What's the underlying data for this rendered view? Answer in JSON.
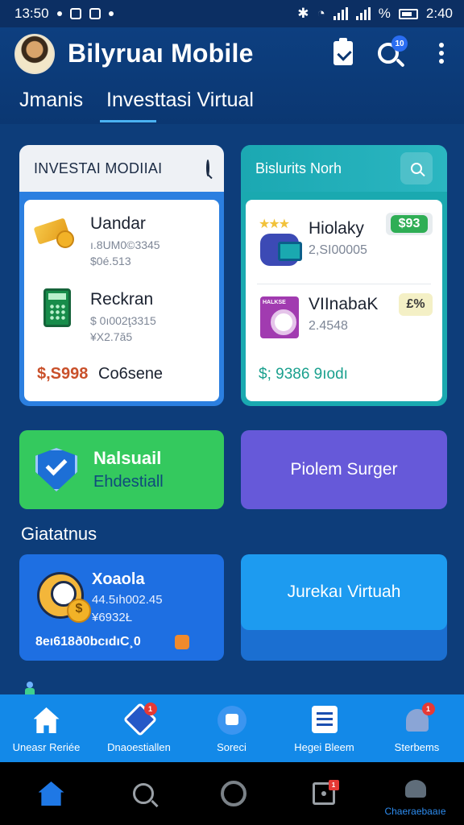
{
  "status_bar": {
    "time_left": "13:50",
    "battery_text": "%",
    "time_right": "2:40"
  },
  "header": {
    "title": "Bilyruaı Mobile",
    "search_badge": "10"
  },
  "tabs": [
    {
      "label": "Jmanis"
    },
    {
      "label": "Investtasi Virtual"
    }
  ],
  "card_left": {
    "title": "INVESTAI MODIIAI",
    "items": [
      {
        "title": "Uandar",
        "line1": "ı.8UM0©3345",
        "line2": "$0é.513",
        "icon": "gold-bars-icon"
      },
      {
        "title": "Reckran",
        "line1": "$ 0ı002ţ3315",
        "line2": "¥X2.7ă5",
        "icon": "calculator-icon"
      }
    ],
    "footer_price": "$,S998",
    "footer_label": "Co6sene"
  },
  "card_right": {
    "title": "Bislurits Norh",
    "items": [
      {
        "title": "Hiolaky",
        "line1": "2,SI00005",
        "badge": "$93",
        "icon": "wallet-icon"
      },
      {
        "title": "VIInabaK",
        "line1": "2.4548",
        "badge": "£%",
        "icon": "shop-icon"
      }
    ],
    "footer": "$; 9386 9ıodı"
  },
  "tiles": {
    "green": {
      "title": "Nalsuail",
      "subtitle": "Ehdestiall"
    },
    "purple": {
      "label": "Piolem Surger"
    },
    "blue": {
      "name": "Xoaola",
      "line1": "44.5ıh002.45",
      "line2": "¥6932Ł",
      "footer": "8eı618ð0bcıdıC¸0"
    },
    "cyan": {
      "label": "Jurekaı Virtuah"
    }
  },
  "section_title": "Giatatnus",
  "bottom_tabs": [
    {
      "label": "Uneasr Reriée",
      "icon": "home-icon"
    },
    {
      "label": "Dnaoestiallen",
      "icon": "diamond-icon",
      "badge": "1"
    },
    {
      "label": "Soreci",
      "icon": "chat-icon"
    },
    {
      "label": "Hegei Bleem",
      "icon": "list-icon"
    },
    {
      "label": "Sterbems",
      "icon": "bell-icon",
      "badge": "1"
    }
  ],
  "nav_bar": {
    "last_label": "Chaeraebaaıe"
  },
  "colors": {
    "background": "#0d3d7a",
    "accent": "#1389e8",
    "green_tile": "#34c95e",
    "purple_tile": "#6659d9"
  }
}
